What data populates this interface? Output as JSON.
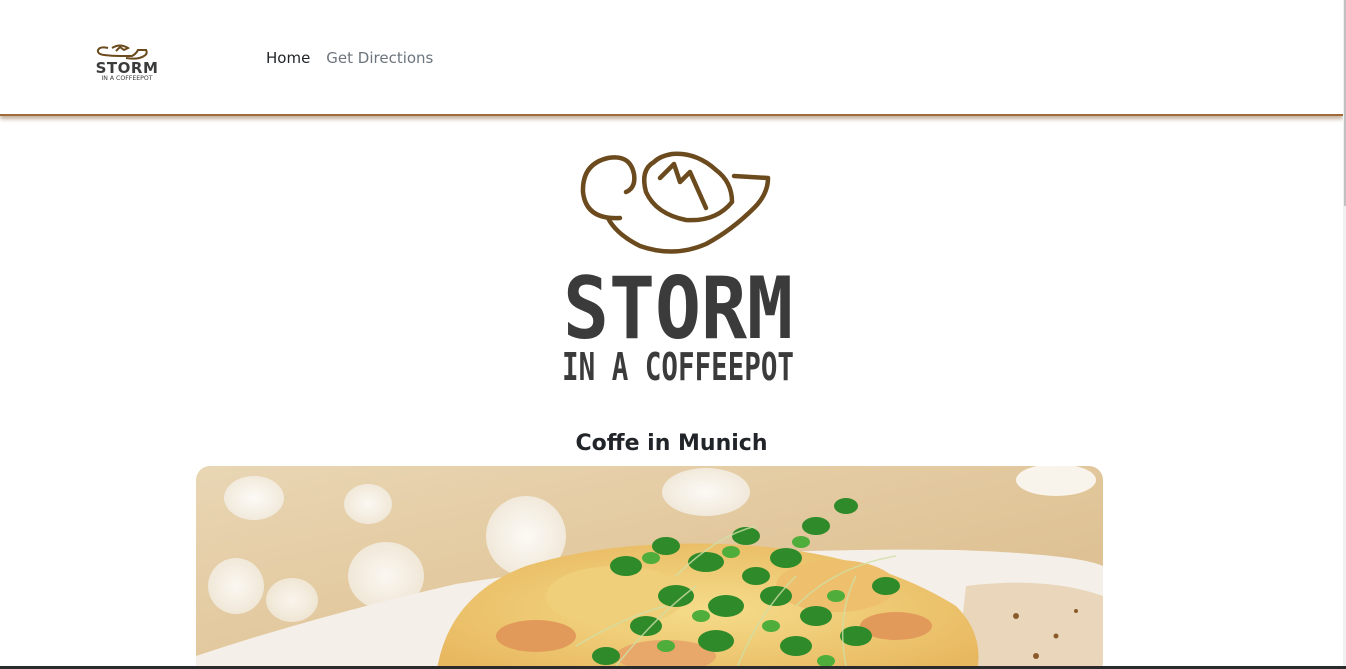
{
  "navbar": {
    "brand_logo": {
      "icon": "storm-coffeepot-logo",
      "word": "STORM",
      "tagline": "IN A COFFEEPOT"
    },
    "links": [
      {
        "label": "Home",
        "active": true
      },
      {
        "label": "Get Directions",
        "active": false
      }
    ],
    "accent_color": "#a06a3a"
  },
  "hero": {
    "logo_icon": "storm-coffeepot-logo",
    "word": "STORM",
    "tagline": "IN A COFFEEPOT",
    "logo_color": "#6b4a1e",
    "text_color": "#3b3b3b"
  },
  "section": {
    "title": "Coffe in Munich"
  },
  "photo": {
    "subject": "plate-with-cress-garnish"
  }
}
